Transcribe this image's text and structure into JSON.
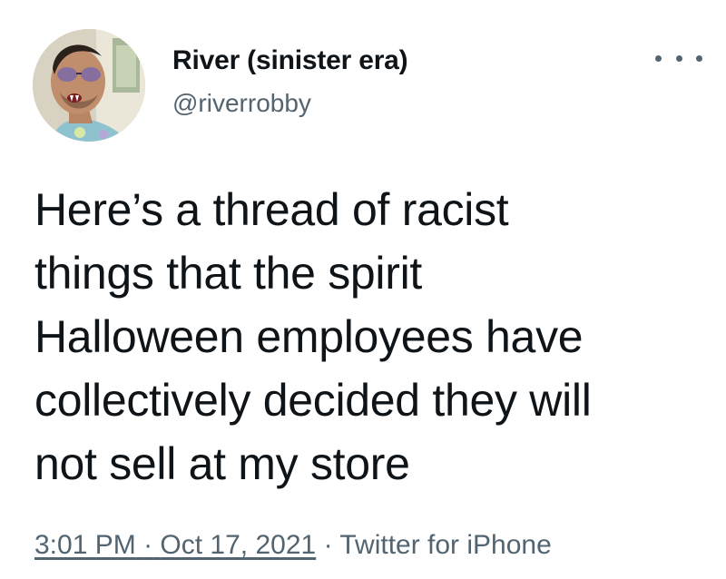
{
  "tweet": {
    "author": {
      "display_name": "River (sinister era)",
      "handle": "@riverrobby"
    },
    "more_icon": "more-horizontal-icon",
    "text": "Here’s a thread of racist\nthings that the spirit\nHalloween employees have\ncollectively decided they will\nnot sell at my store",
    "meta": {
      "time": "3:01 PM",
      "separator": "·",
      "date": "Oct 17, 2021",
      "source": "Twitter for iPhone"
    }
  },
  "colors": {
    "text": "#0f1419",
    "secondary": "#536471",
    "background": "#ffffff"
  }
}
